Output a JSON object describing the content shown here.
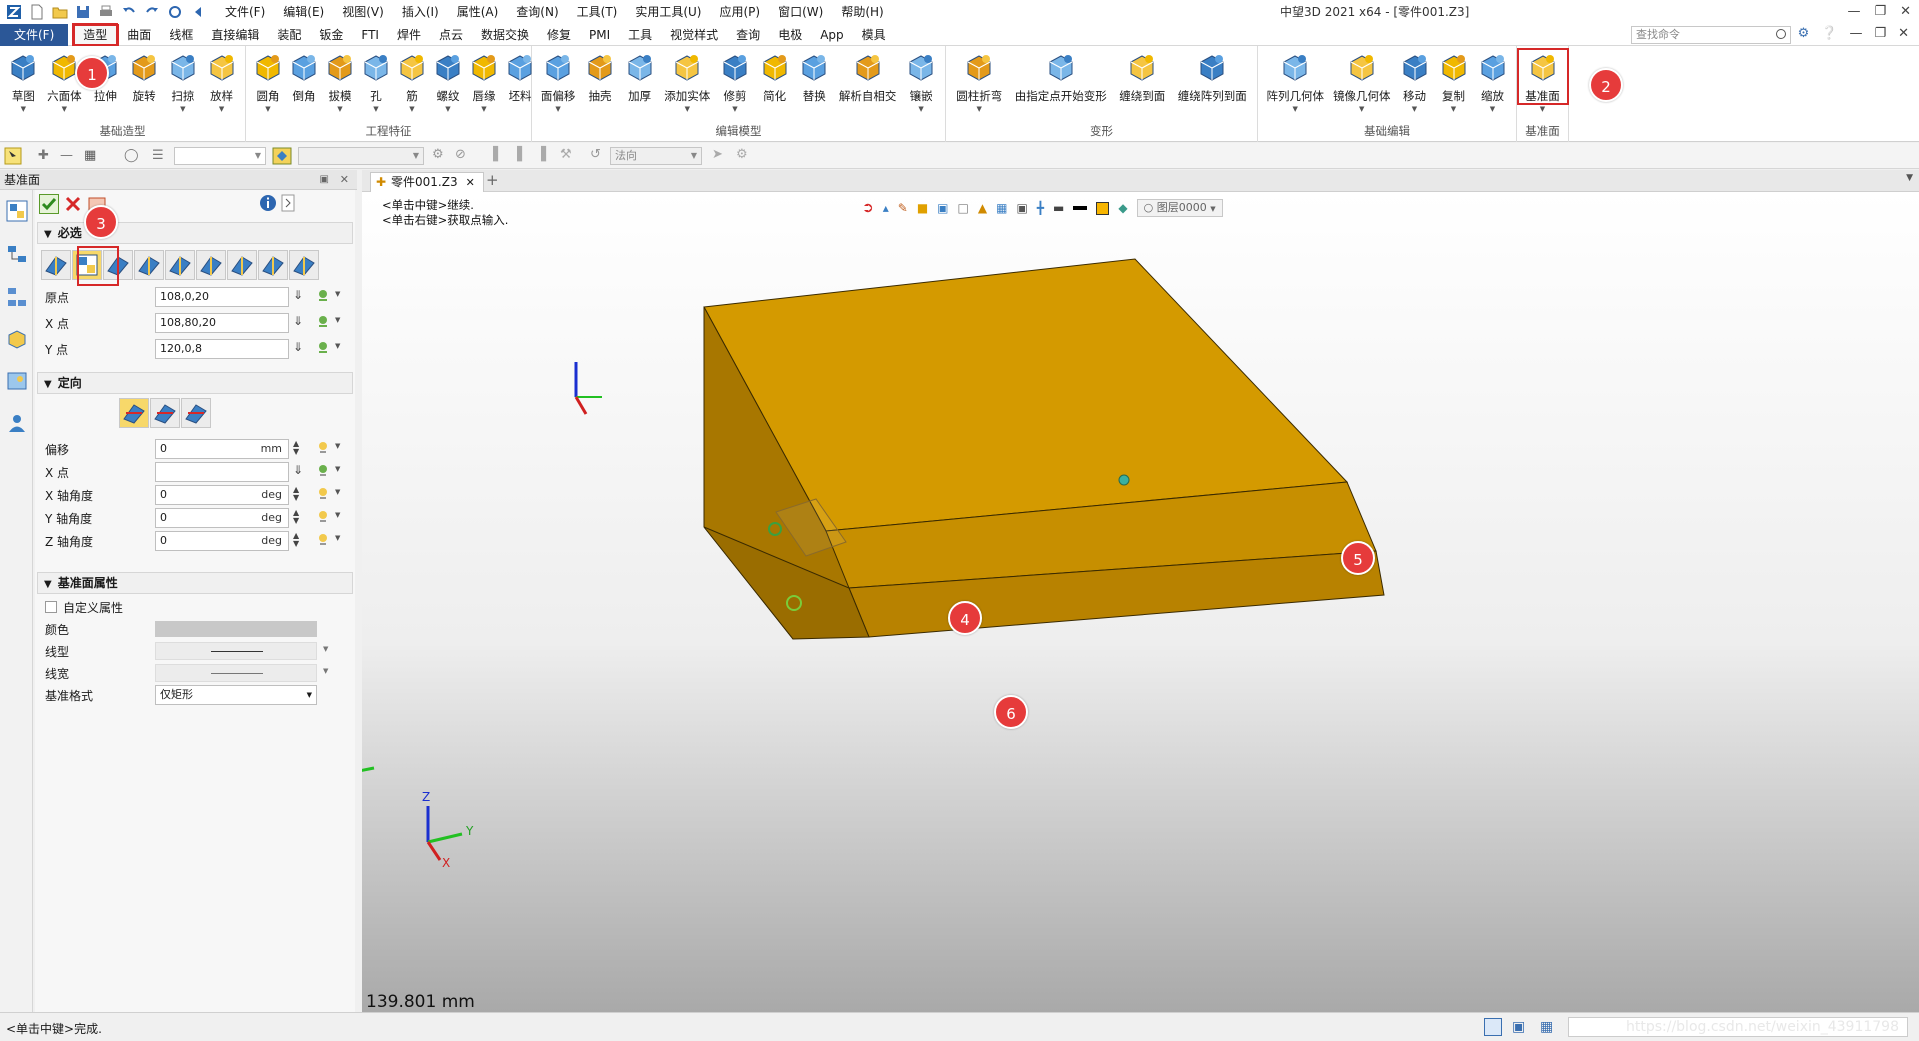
{
  "window": {
    "title": "中望3D 2021 x64 - [零件001.Z3]",
    "menu": [
      "文件(F)",
      "编辑(E)",
      "视图(V)",
      "插入(I)",
      "属性(A)",
      "查询(N)",
      "工具(T)",
      "实用工具(U)",
      "应用(P)",
      "窗口(W)",
      "帮助(H)"
    ]
  },
  "ribbon_tabs": {
    "file": "文件(F)",
    "tabs": [
      "造型",
      "曲面",
      "线框",
      "直接编辑",
      "装配",
      "钣金",
      "FTI",
      "焊件",
      "点云",
      "数据交换",
      "修复",
      "PMI",
      "工具",
      "视觉样式",
      "查询",
      "电极",
      "App",
      "模具"
    ],
    "active": "造型",
    "search_placeholder": "查找命令"
  },
  "ribbon": {
    "groups": [
      {
        "name": "基础造型",
        "buttons": [
          {
            "label": "草图",
            "icon": "sketch-icon",
            "dd": true
          },
          {
            "label": "六面体",
            "icon": "box-icon",
            "dd": true
          },
          {
            "label": "拉伸",
            "icon": "extrude-icon",
            "dd": false
          },
          {
            "label": "旋转",
            "icon": "revolve-icon",
            "dd": false
          },
          {
            "label": "扫掠",
            "icon": "sweep-icon",
            "dd": true
          },
          {
            "label": "放样",
            "icon": "loft-icon",
            "dd": true
          }
        ]
      },
      {
        "name": "工程特征",
        "buttons": [
          {
            "label": "圆角",
            "icon": "fillet-icon",
            "dd": true
          },
          {
            "label": "倒角",
            "icon": "chamfer-icon",
            "dd": false
          },
          {
            "label": "拔模",
            "icon": "draft-icon",
            "dd": true
          },
          {
            "label": "孔",
            "icon": "hole-icon",
            "dd": true
          },
          {
            "label": "筋",
            "icon": "rib-icon",
            "dd": true
          },
          {
            "label": "螺纹",
            "icon": "thread-icon",
            "dd": true
          },
          {
            "label": "唇缘",
            "icon": "lip-icon",
            "dd": true
          },
          {
            "label": "坯料",
            "icon": "stock-icon",
            "dd": false
          }
        ]
      },
      {
        "name": "编辑模型",
        "buttons": [
          {
            "label": "面偏移",
            "icon": "face-offset-icon",
            "dd": true
          },
          {
            "label": "抽壳",
            "icon": "shell-icon",
            "dd": false
          },
          {
            "label": "加厚",
            "icon": "thicken-icon",
            "dd": false
          },
          {
            "label": "添加实体",
            "icon": "add-solid-icon",
            "dd": true
          },
          {
            "label": "修剪",
            "icon": "trim-icon",
            "dd": true
          },
          {
            "label": "简化",
            "icon": "simplify-icon",
            "dd": false
          },
          {
            "label": "替换",
            "icon": "replace-icon",
            "dd": false
          },
          {
            "label": "解析自相交",
            "icon": "self-intersect-icon",
            "dd": false
          },
          {
            "label": "镶嵌",
            "icon": "inlay-icon",
            "dd": true
          }
        ]
      },
      {
        "name": "变形",
        "buttons": [
          {
            "label": "圆柱折弯",
            "icon": "cylinder-bend-icon",
            "dd": true
          },
          {
            "label": "由指定点开始变形",
            "icon": "point-deform-icon",
            "dd": false
          },
          {
            "label": "缠绕到面",
            "icon": "wrap-face-icon",
            "dd": false
          },
          {
            "label": "缠绕阵列到面",
            "icon": "wrap-pattern-icon",
            "dd": false
          }
        ]
      },
      {
        "name": "基础编辑",
        "buttons": [
          {
            "label": "阵列几何体",
            "icon": "pattern-icon",
            "dd": true
          },
          {
            "label": "镜像几何体",
            "icon": "mirror-icon",
            "dd": true
          },
          {
            "label": "移动",
            "icon": "move-icon",
            "dd": true
          },
          {
            "label": "复制",
            "icon": "copy-icon",
            "dd": true
          },
          {
            "label": "缩放",
            "icon": "scale-icon",
            "dd": true
          }
        ]
      },
      {
        "name": "基准面",
        "buttons": [
          {
            "label": "基准面",
            "icon": "datum-plane-icon",
            "dd": true
          }
        ]
      }
    ]
  },
  "toolbar": {
    "filter_value": "",
    "mode_value": "",
    "normal_value": "法向"
  },
  "panel": {
    "title": "基准面",
    "sections": {
      "required": "必选",
      "orientation": "定向",
      "properties": "基准面属性"
    },
    "required": {
      "fields": [
        {
          "label": "原点",
          "value": "108,0,20"
        },
        {
          "label": "X 点",
          "value": "108,80,20"
        },
        {
          "label": "Y 点",
          "value": "120,0,8"
        }
      ]
    },
    "orientation": {
      "fields": [
        {
          "label": "偏移",
          "value": "0",
          "unit": "mm"
        },
        {
          "label": "X 点",
          "value": "",
          "unit": ""
        },
        {
          "label": "X 轴角度",
          "value": "0",
          "unit": "deg"
        },
        {
          "label": "Y 轴角度",
          "value": "0",
          "unit": "deg"
        },
        {
          "label": "Z 轴角度",
          "value": "0",
          "unit": "deg"
        }
      ]
    },
    "properties": {
      "custom_label": "自定义属性",
      "color_label": "颜色",
      "color_value": "#c8c8c8",
      "linetype_label": "线型",
      "linewidth_label": "线宽",
      "format_label": "基准格式",
      "format_value": "仅矩形"
    }
  },
  "document": {
    "tab_label": "零件001.Z3",
    "prompt_line1": "<单击中键>继续.",
    "prompt_line2": "<单击右键>获取点输入.",
    "layer": "图层0000",
    "measurement": "139.801 mm",
    "axes": {
      "z": "Z",
      "y": "Y",
      "x": "X"
    },
    "body_color": "#d49a00"
  },
  "markers": [
    "1",
    "2",
    "3",
    "4",
    "5",
    "6"
  ],
  "status": {
    "text": "<单击中键>完成.",
    "watermark": "https://blog.csdn.net/weixin_43911798"
  }
}
